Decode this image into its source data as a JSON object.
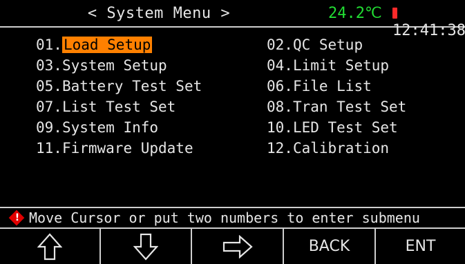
{
  "header": {
    "title": "< System Menu >",
    "temperature": "24.2℃",
    "time": "12:41:38"
  },
  "menu": {
    "items": [
      {
        "number": "01.",
        "label": "Load Setup",
        "selected": true
      },
      {
        "number": "02.",
        "label": "QC Setup"
      },
      {
        "number": "03.",
        "label": "System Setup"
      },
      {
        "number": "04.",
        "label": "Limit Setup"
      },
      {
        "number": "05.",
        "label": "Battery Test Set"
      },
      {
        "number": "06.",
        "label": "File List"
      },
      {
        "number": "07.",
        "label": "List Test Set"
      },
      {
        "number": "08.",
        "label": "Tran Test Set"
      },
      {
        "number": "09.",
        "label": "System Info"
      },
      {
        "number": "10.",
        "label": "LED Test Set"
      },
      {
        "number": "11.",
        "label": "Firmware Update"
      },
      {
        "number": "12.",
        "label": "Calibration"
      }
    ]
  },
  "status": {
    "icon": "warning-icon",
    "message": "Move Cursor or put two numbers to enter submenu"
  },
  "softkeys": {
    "up": {
      "icon": "arrow-up-icon"
    },
    "down": {
      "icon": "arrow-down-icon"
    },
    "right": {
      "icon": "arrow-right-icon"
    },
    "back_label": "BACK",
    "enter_label": "ENT"
  },
  "colors": {
    "background": "#000000",
    "selection": "#ff8000",
    "temperature": "#22dd33",
    "warning": "#e00000"
  }
}
